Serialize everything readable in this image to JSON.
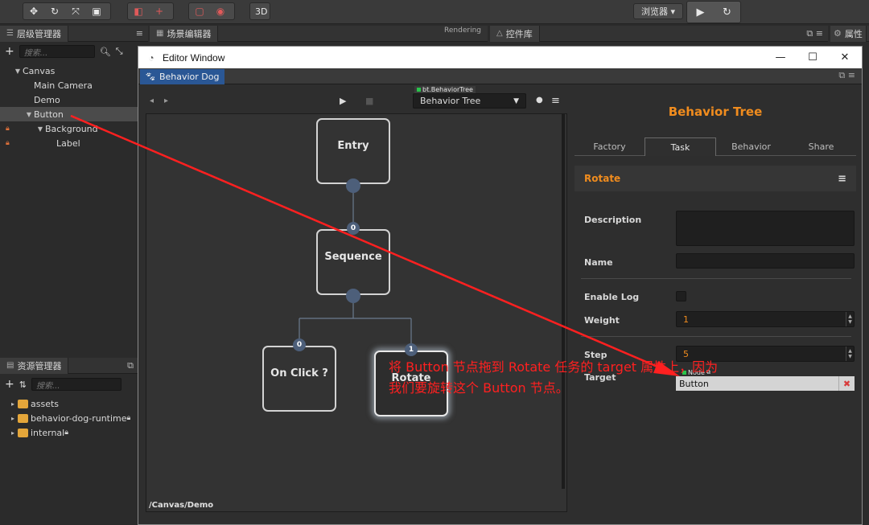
{
  "toolbar": {
    "browser_select": "浏览器 ▾",
    "mode_3d": "3D"
  },
  "hierarchy": {
    "tab_label": "层级管理器",
    "search_placeholder": "搜索...",
    "items": [
      {
        "label": "Canvas",
        "depth": 0,
        "expanded": true,
        "locked": false,
        "selected": false
      },
      {
        "label": "Main Camera",
        "depth": 1,
        "expanded": false,
        "locked": false,
        "selected": false
      },
      {
        "label": "Demo",
        "depth": 1,
        "expanded": false,
        "locked": false,
        "selected": false
      },
      {
        "label": "Button",
        "depth": 1,
        "expanded": true,
        "locked": false,
        "selected": true
      },
      {
        "label": "Background",
        "depth": 2,
        "expanded": true,
        "locked": true,
        "selected": false
      },
      {
        "label": "Label",
        "depth": 3,
        "expanded": false,
        "locked": true,
        "selected": false
      }
    ]
  },
  "scene_editor": {
    "tab_label": "场景编辑器",
    "render_label": "Rendering"
  },
  "widget_lib": {
    "tab_label": "控件库"
  },
  "properties": {
    "tab_label": "属性"
  },
  "assets": {
    "tab_label": "资源管理器",
    "search_placeholder": "搜索...",
    "items": [
      {
        "label": "assets",
        "locked": false
      },
      {
        "label": "behavior-dog-runtime",
        "locked": true
      },
      {
        "label": "internal",
        "locked": true
      }
    ]
  },
  "editor_window": {
    "title": "Editor Window",
    "tab": "Behavior Dog",
    "tree_badge": "bt.BehaviorTree",
    "tree_select": "Behavior Tree",
    "path": "/Canvas/Demo"
  },
  "graph": {
    "nodes": [
      {
        "id": "entry",
        "label": "Entry"
      },
      {
        "id": "sequence",
        "label": "Sequence",
        "index": "0"
      },
      {
        "id": "onclick",
        "label": "On Click ?",
        "index": "0"
      },
      {
        "id": "rotate",
        "label": "Rotate",
        "index": "1",
        "active": true
      }
    ]
  },
  "inspector": {
    "title": "Behavior Tree",
    "tabs": [
      "Factory",
      "Task",
      "Behavior",
      "Share"
    ],
    "active_tab": "Task",
    "task_name": "Rotate",
    "props": {
      "description_label": "Description",
      "description_value": "",
      "name_label": "Name",
      "name_value": "",
      "enable_log_label": "Enable Log",
      "enable_log_value": false,
      "weight_label": "Weight",
      "weight_value": "1",
      "step_label": "Step",
      "step_value": "5",
      "target_label": "Target",
      "target_badge": "Node",
      "target_value": "Button"
    }
  },
  "annotation": {
    "text": "将 Button 节点拖到 Rotate 任务的 target 属性上，因为我们要旋转这个 Button 节点。",
    "color": "#ff2020"
  },
  "colors": {
    "accent_orange": "#f08c1e",
    "tab_blue": "#2a5795",
    "port_blue": "#4d5f7a",
    "arrow_red": "#ff2020"
  }
}
